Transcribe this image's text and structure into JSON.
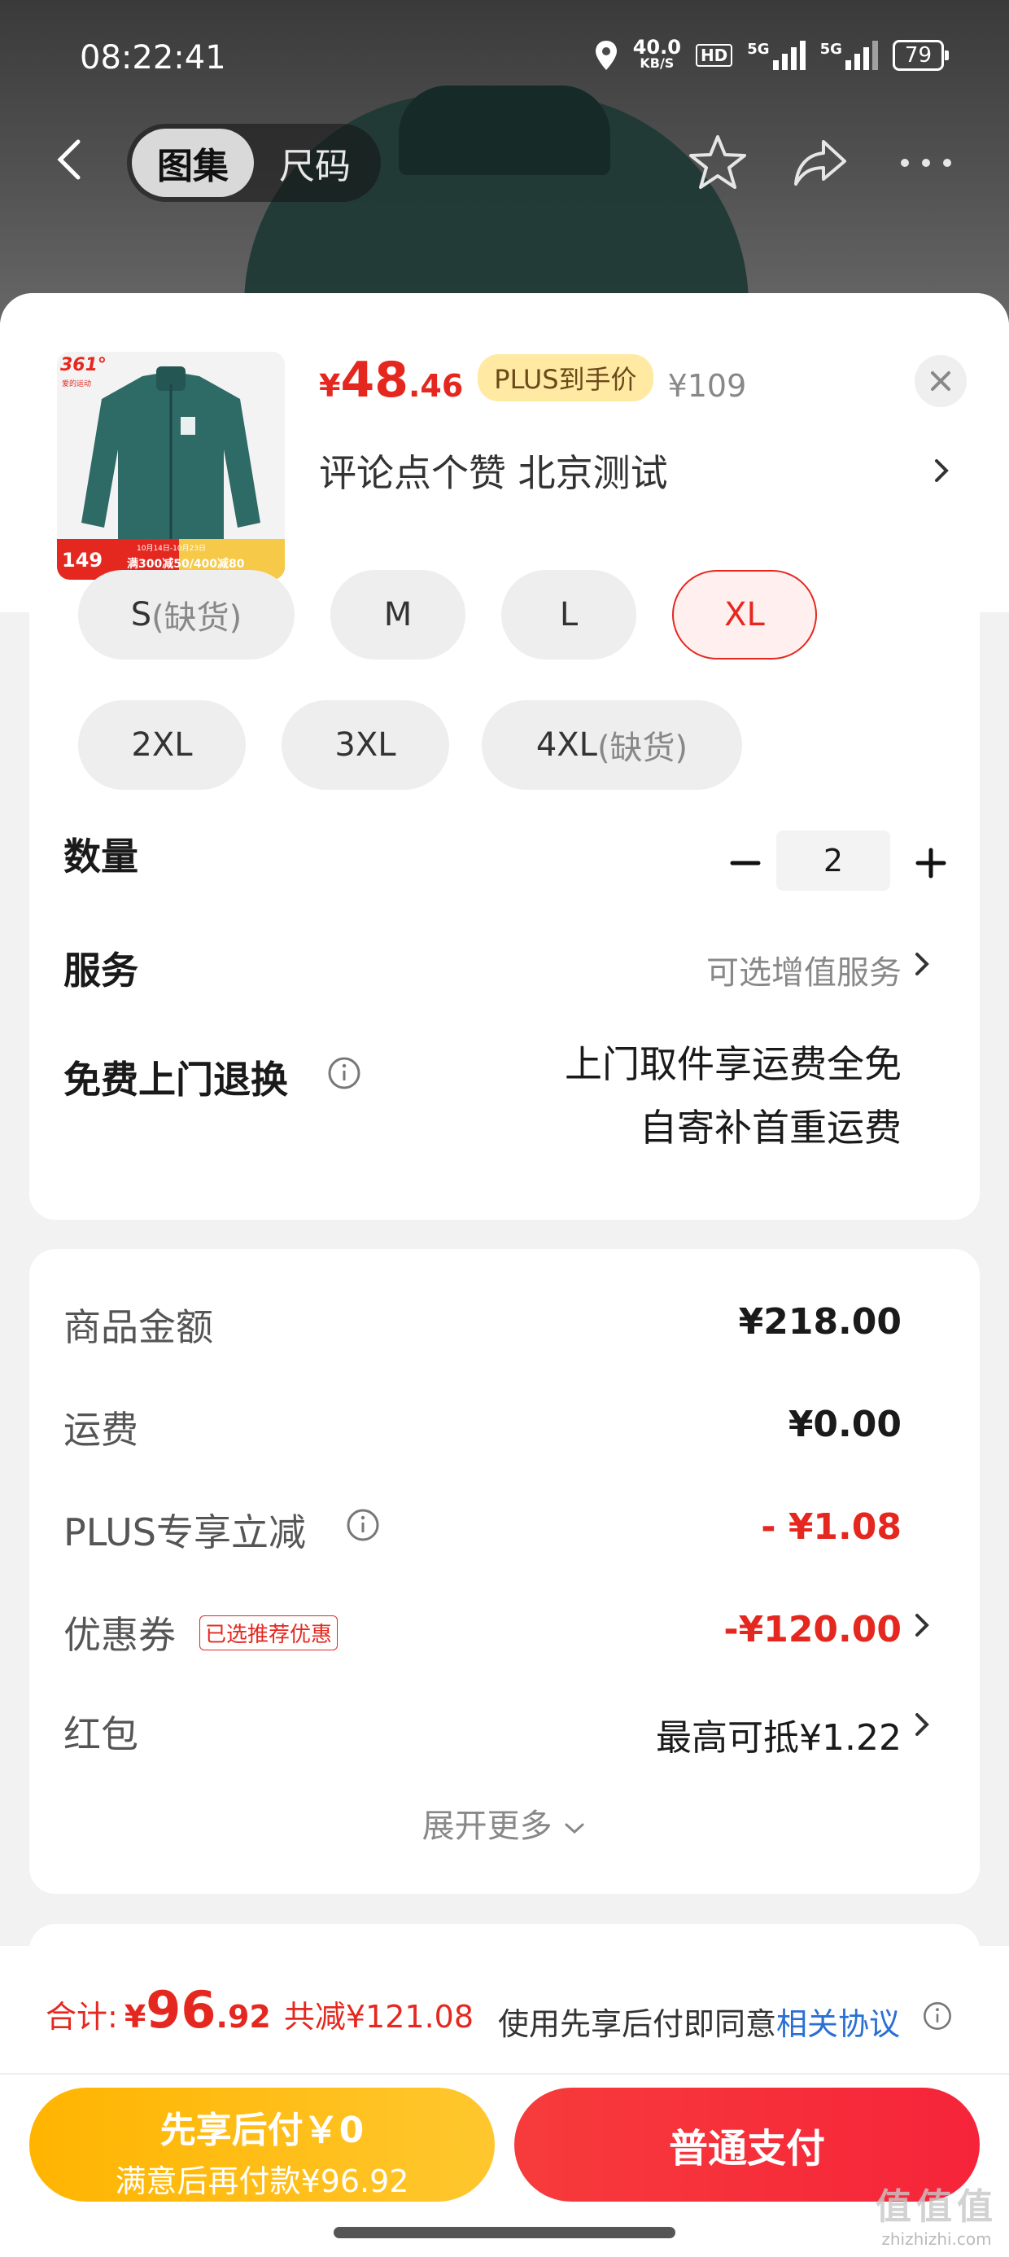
{
  "status_bar": {
    "time": "08:22:41",
    "net_speed_top": "40.0",
    "net_speed_unit": "KB/S",
    "hd_badge": "HD",
    "signal1_label": "5G",
    "signal2_label": "5G",
    "battery": "79"
  },
  "top_nav": {
    "tab_gallery": "图集",
    "tab_size": "尺码"
  },
  "product": {
    "price_symbol": "¥",
    "price_int": "48",
    "price_dec": ".46",
    "plus_badge": "PLUS到手价",
    "original_price": "¥109",
    "selected_text": "评论点个赞  北京测试",
    "thumb_brand": "361°",
    "thumb_brand_sub": "爱的运动",
    "thumb_price_badge": "149",
    "thumb_promo": "满300减50/400减80",
    "thumb_promo_date": "10月14日-10月23日"
  },
  "sizes": {
    "row1": [
      {
        "label": "S",
        "note": "(缺货)"
      },
      {
        "label": "M",
        "note": ""
      },
      {
        "label": "L",
        "note": ""
      },
      {
        "label": "XL",
        "note": ""
      }
    ],
    "row2": [
      {
        "label": "2XL",
        "note": ""
      },
      {
        "label": "3XL",
        "note": ""
      },
      {
        "label": "4XL",
        "note": "(缺货)"
      }
    ]
  },
  "quantity": {
    "label": "数量",
    "value": "2"
  },
  "service": {
    "label": "服务",
    "value": "可选增值服务"
  },
  "free_return": {
    "label": "免费上门退换",
    "line1": "上门取件享运费全免",
    "line2": "自寄补首重运费"
  },
  "fees": {
    "goods_label": "商品金额",
    "goods_value": "¥218.00",
    "shipping_label": "运费",
    "shipping_value": "¥0.00",
    "plus_label": "PLUS专享立减",
    "plus_value": "- ¥1.08",
    "coupon_label": "优惠券",
    "coupon_tag": "已选推荐优惠",
    "coupon_value": "-¥120.00",
    "redpack_label": "红包",
    "redpack_value": "最高可抵¥1.22",
    "expand": "展开更多"
  },
  "footer": {
    "total_label": "合计:",
    "total_yen": "¥",
    "total_int": "96",
    "total_dec": ".92",
    "total_saved": "共减¥121.08",
    "agree_text": "使用先享后付即同意",
    "agree_link": "相关协议",
    "btn_later_line1": "先享后付￥0",
    "btn_later_line2": "满意后再付款¥96.92",
    "btn_pay": "普通支付"
  },
  "watermark": {
    "big": "值值值",
    "small": "zhizhizhi.com"
  },
  "colors": {
    "accent_red": "#e5281f",
    "link_blue": "#2a6fd4",
    "later_button": "#ffb400",
    "pay_button": "#f6243a"
  }
}
